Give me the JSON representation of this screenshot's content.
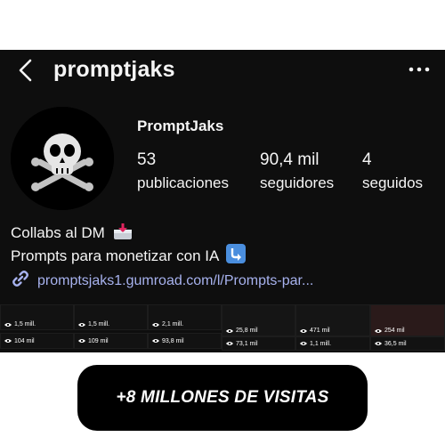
{
  "header": {
    "username": "promptjaks",
    "back_icon": "chevron-left-icon",
    "more_icon": "more-horizontal-icon"
  },
  "profile": {
    "display_name": "PromptJaks",
    "avatar_icon": "skull-crossbones-icon",
    "stats": {
      "posts": {
        "value": "53",
        "label": "publicaciones"
      },
      "followers": {
        "value": "90,4 mil",
        "label": "seguidores"
      },
      "following": {
        "value": "4",
        "label": "seguidos"
      }
    },
    "bio_line_1": "Collabs al DM",
    "bio_line_1_emoji": "inbox-tray-icon",
    "bio_line_2": "Prompts para monetizar con IA",
    "bio_line_2_emoji": "arrow-down-right-icon",
    "link_icon": "link-icon",
    "link": "promptsjaks1.gumroad.com/l/Prompts-par..."
  },
  "reel_views": {
    "row_1": [
      "1,5 mill.",
      "1,5 mill.",
      "2,1 mill.",
      "25,8 mil",
      "471 mil",
      "254 mil"
    ],
    "row_2": [
      "104 mil",
      "109 mil",
      "93,8 mil",
      "73,1 mil",
      "1,1 mill.",
      "36,5 mil"
    ]
  },
  "banner": {
    "text": "+8 MILLONES DE VISITAS"
  },
  "colors": {
    "background": "#0e0e0e",
    "link": "#a7b2ee",
    "text": "#f5f5f5"
  }
}
